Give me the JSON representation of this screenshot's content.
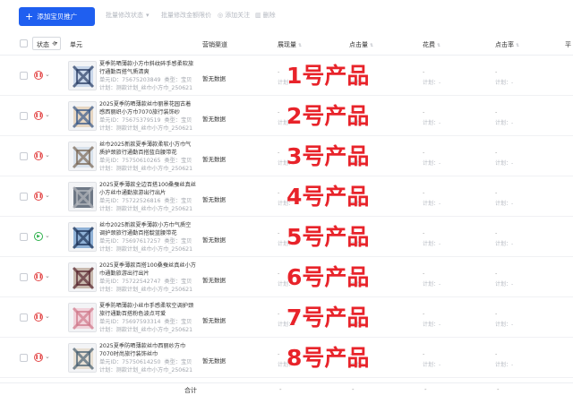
{
  "toolbar": {
    "add_button": "添加宝贝推广",
    "batch_status": "批量修改状态",
    "batch_budget": "批量修改金额限价",
    "add_follow": "添加关注",
    "delete": "删除"
  },
  "table": {
    "headers": {
      "status": "状态",
      "unit": "单元",
      "marketing_scene": "营销渠道",
      "impressions": "展现量",
      "clicks": "点击量",
      "cost": "花费",
      "ctr": "点击率",
      "avg": "平"
    },
    "rows": [
      {
        "title": "夏季防晒薄款小方巾斜纹碎手感柔软旅行通勤百搭气质清爽",
        "unit_id": "单元ID：75675203849",
        "type": "类型：宝贝",
        "plan": "计划：测款计划_丝巾小方巾_250621",
        "market": "暂无数据",
        "label": "1号产品",
        "status": "off"
      },
      {
        "title": "2025夏季防晒薄款丝巾丽景花园古着感西丽织小方巾7070旅行装饰纱",
        "unit_id": "单元ID：75675379519",
        "type": "类型：宝贝",
        "plan": "计划：测款计划_丝巾小方巾_250621",
        "market": "暂无数据",
        "label": "2号产品",
        "status": "off"
      },
      {
        "title": "丝巾2025新款夏季薄款柔软小方巾气质护颈旅行通勤百搭蓝白腰带花",
        "unit_id": "单元ID：75750610265",
        "type": "类型：宝贝",
        "plan": "计划：测款计划_丝巾小方巾_250621",
        "market": "暂无数据",
        "label": "3号产品",
        "status": "off"
      },
      {
        "title": "2025夏季薄款全边百搭100桑蚕丝真丝小方丝巾通勤旅游出行出片",
        "unit_id": "单元ID：75722526816",
        "type": "类型：宝贝",
        "plan": "计划：测款计划_丝巾小方巾_250621",
        "market": "暂无数据",
        "label": "4号产品",
        "status": "off"
      },
      {
        "title": "丝巾2025新款夏季薄款小方巾气质空调护颈旅行通勤百搭靛蓝腰带花",
        "unit_id": "单元ID：75697617257",
        "type": "类型：宝贝",
        "plan": "计划：测款计划_丝巾小方巾_250621",
        "market": "暂无数据",
        "label": "5号产品",
        "status": "on"
      },
      {
        "title": "2025夏季薄款百搭100桑蚕丝真丝小方巾通勤旅游出行出片",
        "unit_id": "单元ID：75722542747",
        "type": "类型：宝贝",
        "plan": "计划：测款计划_丝巾小方巾_250621",
        "market": "暂无数据",
        "label": "6号产品",
        "status": "off"
      },
      {
        "title": "夏季防晒薄款小丝巾手感柔软空调护颈旅行通勤百搭粉色波点可爱",
        "unit_id": "单元ID：75697593314",
        "type": "类型：宝贝",
        "plan": "计划：测款计划_丝巾小方巾_250621",
        "market": "暂无数据",
        "label": "7号产品",
        "status": "off"
      },
      {
        "title": "2025夏季防晒薄款丝巾西丽纱方巾7070时尚旅行装饰丝巾",
        "unit_id": "单元ID：75750614250",
        "type": "类型：宝贝",
        "plan": "计划：测款计划_丝巾小方巾_250621",
        "market": "暂无数据",
        "label": "8号产品",
        "status": "off"
      }
    ],
    "dash": "-",
    "sub_dash": "计划：-",
    "footer_total": "合计"
  },
  "colors": {
    "primary": "#1f5ff0",
    "label_red": "#e8232a",
    "status_off": "#e34848",
    "status_on": "#2bb04a"
  }
}
